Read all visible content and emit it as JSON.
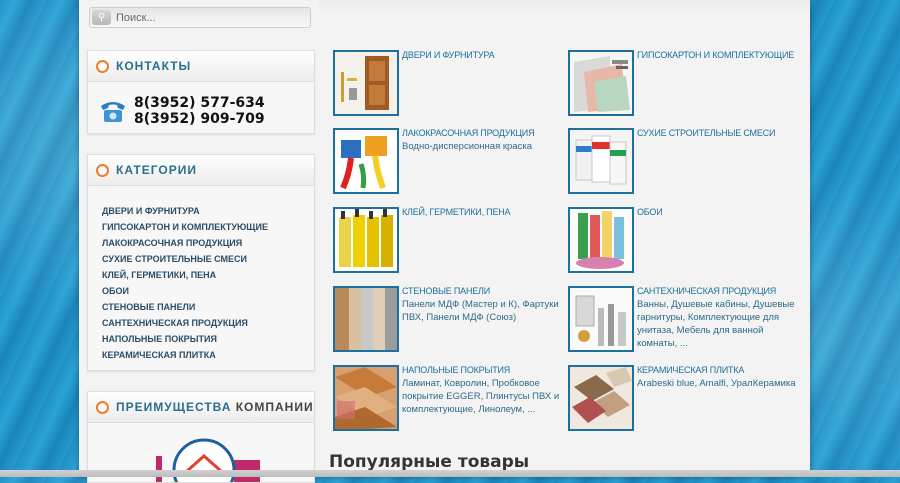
{
  "search": {
    "placeholder": "Поиск..."
  },
  "contacts": {
    "title": "КОНТАКТЫ",
    "phones": [
      "8(3952) 577-634",
      "8(3952) 909-709"
    ]
  },
  "categories": {
    "title": "КАТЕГОРИИ",
    "items": [
      "ДВЕРИ И ФУРНИТУРА",
      "ГИПСОКАРТОН И КОМПЛЕКТУЮЩИЕ",
      "ЛАКОКРАСОЧНАЯ ПРОДУКЦИЯ",
      "СУХИЕ СТРОИТЕЛЬНЫЕ СМЕСИ",
      "КЛЕЙ, ГЕРМЕТИКИ, ПЕНА",
      "ОБОИ",
      "СТЕНОВЫЕ ПАНЕЛИ",
      "САНТЕХНИЧЕСКАЯ ПРОДУКЦИЯ",
      "НАПОЛЬНЫЕ ПОКРЫТИЯ",
      "КЕРАМИЧЕСКАЯ ПЛИТКА"
    ]
  },
  "advantages": {
    "title_part1": "ПРЕИМУЩЕСТВА",
    "title_part2": "КОМПАНИИ"
  },
  "grid": [
    {
      "title": "ДВЕРИ И ФУРНИТУРА",
      "desc": "",
      "icon": "doors-image"
    },
    {
      "title": "ГИПСОКАРТОН И КОМПЛЕКТУЮЩИЕ",
      "desc": "",
      "icon": "drywall-image"
    },
    {
      "title": "ЛАКОКРАСОЧНАЯ ПРОДУКЦИЯ",
      "desc": "Водно-дисперсионная краска",
      "icon": "paint-image"
    },
    {
      "title": "СУХИЕ СТРОИТЕЛЬНЫЕ СМЕСИ",
      "desc": "",
      "icon": "dry-mix-image"
    },
    {
      "title": "КЛЕЙ, ГЕРМЕТИКИ, ПЕНА",
      "desc": "",
      "icon": "sealant-image"
    },
    {
      "title": "ОБОИ",
      "desc": "",
      "icon": "wallpaper-image"
    },
    {
      "title": "СТЕНОВЫЕ ПАНЕЛИ",
      "desc": "Панели МДФ (Мастер и К), Фартуки ПВХ, Панели МДФ (Союз)",
      "icon": "wall-panels-image"
    },
    {
      "title": "САНТЕХНИЧЕСКАЯ ПРОДУКЦИЯ",
      "desc": "Ванны, Душевые кабины, Душевые гарнитуры, Комплектующие для унитаза, Мебель для ванной комнаты, ...",
      "icon": "plumbing-image"
    },
    {
      "title": "НАПОЛЬНЫЕ ПОКРЫТИЯ",
      "desc": "Ламинат, Ковролин, Пробковое покрытие EGGER, Плинтусы ПВХ и комплектующие, Линолеум, ...",
      "icon": "flooring-image"
    },
    {
      "title": "КЕРАМИЧЕСКАЯ ПЛИТКА",
      "desc": "Arabeski blue, Amalfi, УралКерамика",
      "icon": "tiles-image"
    }
  ],
  "popular": {
    "title": "Популярные товары"
  },
  "colors": {
    "accent": "#1d6f9e",
    "orange": "#f07c2a",
    "background_water": "#1f8fc4"
  }
}
